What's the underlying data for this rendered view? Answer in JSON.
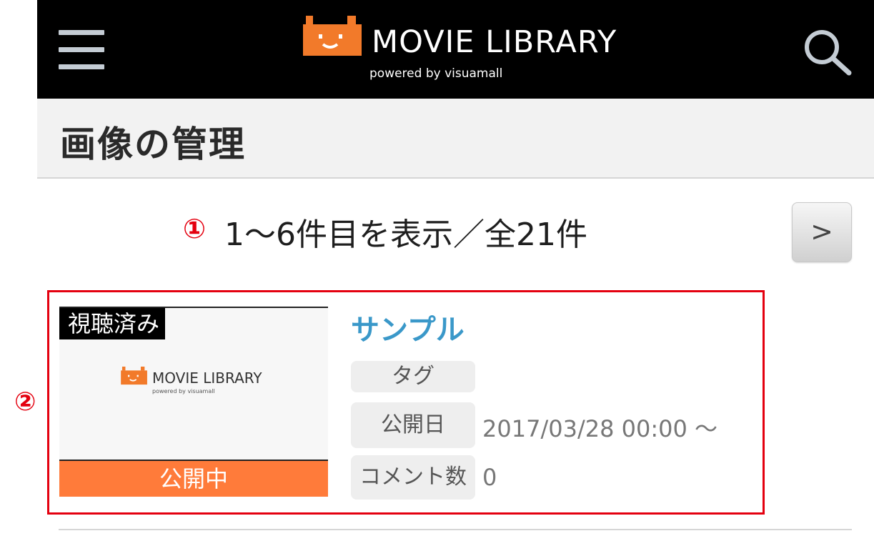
{
  "header": {
    "logo_text": "MOVIE LIBRARY",
    "logo_subtitle": "powered by visuamall"
  },
  "page": {
    "title": "画像の管理"
  },
  "pagination": {
    "marker": "①",
    "info": "1〜6件目を表示／全21件",
    "next_label": ">"
  },
  "item": {
    "marker": "②",
    "watched_badge": "視聴済み",
    "thumbnail_logo_text": "MOVIE LIBRARY",
    "thumbnail_logo_subtitle": "powered by visuamall",
    "status": "公開中",
    "title": "サンプル",
    "meta": {
      "tag_label": "タグ",
      "tag_value": "",
      "publish_label": "公開日",
      "publish_value": "2017/03/28 00:00 〜",
      "comments_label": "コメント数",
      "comments_value": "0"
    }
  },
  "colors": {
    "header_bg": "#000000",
    "brand_orange": "#f27a2a",
    "status_orange": "#ff7b3a",
    "link_blue": "#3a98c9",
    "annotation_red": "#e4000f"
  },
  "icons": [
    "hamburger-menu-icon",
    "search-icon",
    "logo-mascot-icon"
  ]
}
